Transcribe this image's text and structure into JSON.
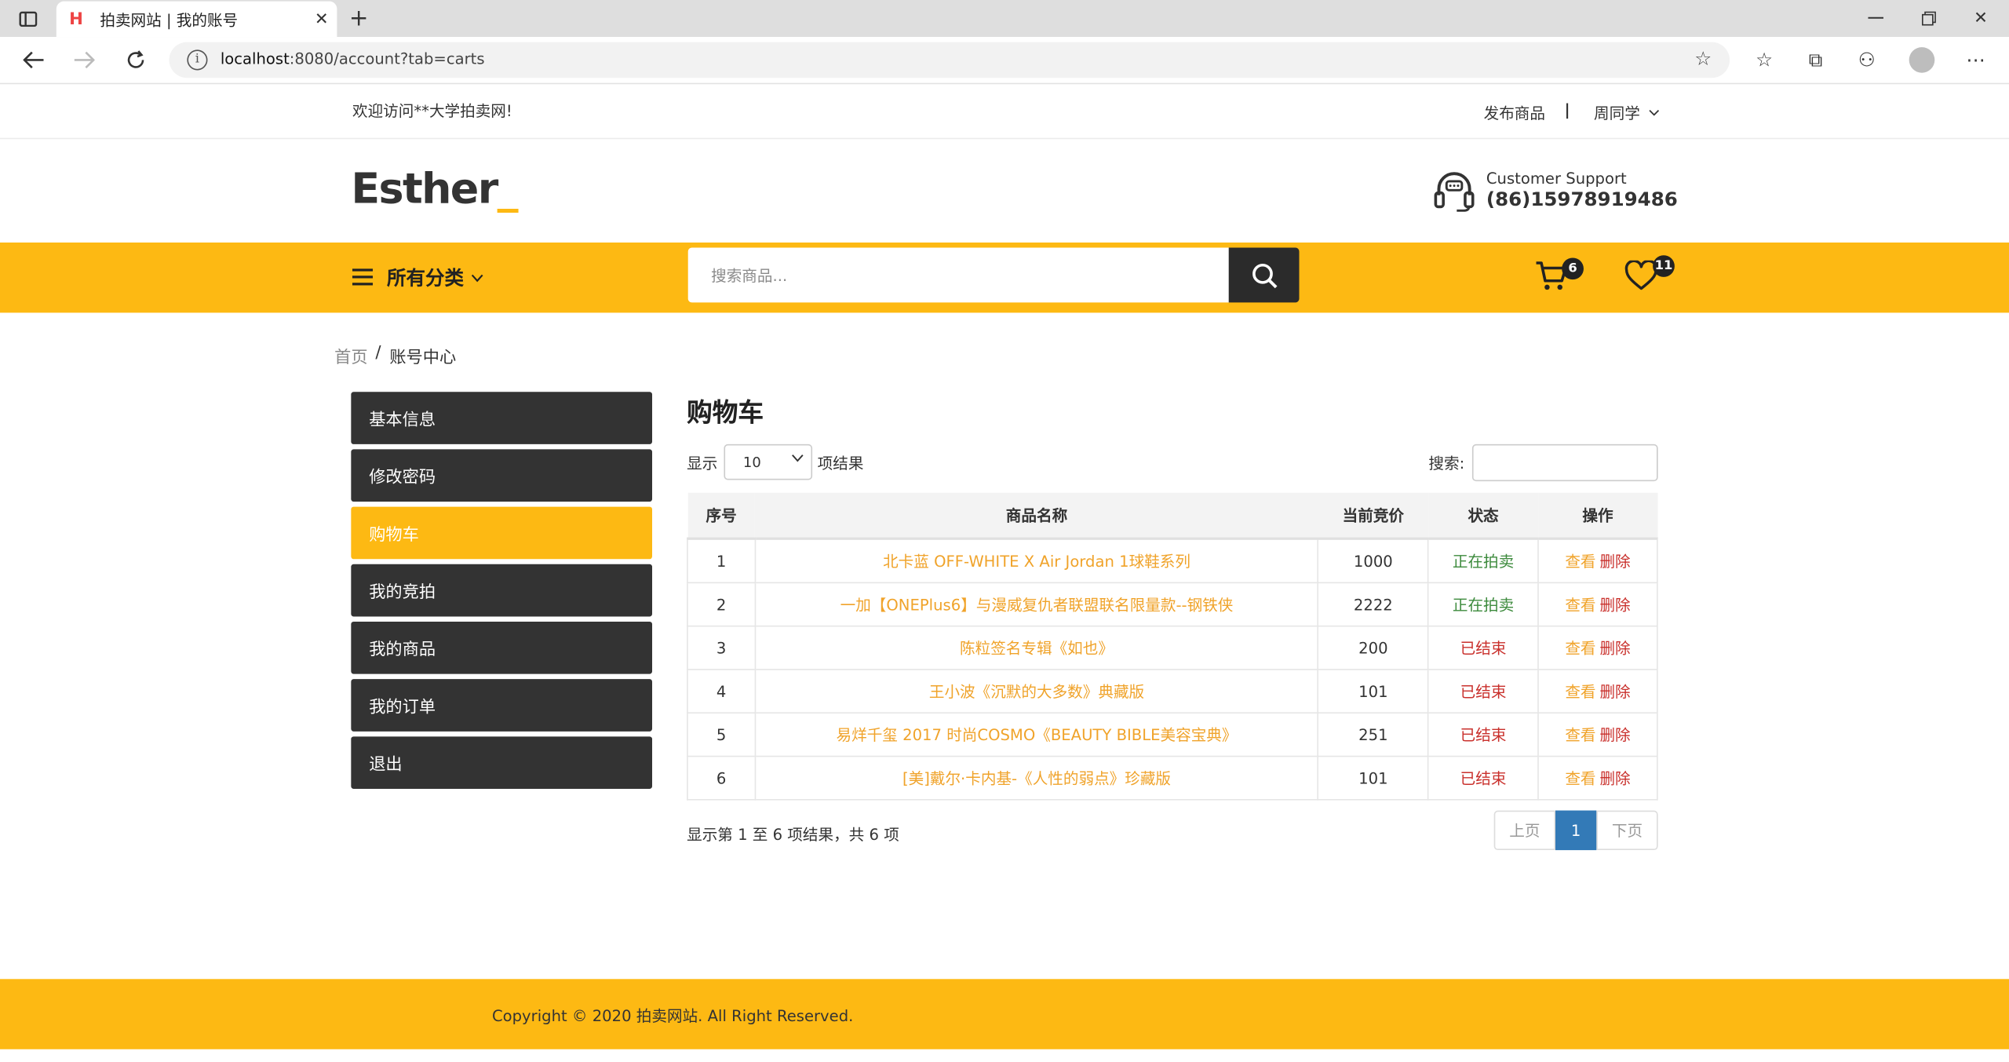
{
  "browser": {
    "tab_title": "拍卖网站 | 我的账号",
    "url_host": "localhost",
    "url_rest": ":8080/account?tab=carts"
  },
  "site": {
    "welcome": "欢迎访问**大学拍卖网!",
    "publish_link": "发布商品",
    "separator": "|",
    "user_menu": "周同学",
    "logo": "Esther",
    "logo_suffix": "_",
    "support_label": "Customer Support",
    "support_phone": "(86)15978919486",
    "all_categories": "所有分类",
    "search_placeholder": "搜索商品...",
    "cart_count": "6",
    "wishlist_count": "11",
    "accent_color": "#fdb913"
  },
  "breadcrumb": {
    "home": "首页",
    "sep": "/",
    "current": "账号中心"
  },
  "sidebar": {
    "items": [
      {
        "label": "基本信息",
        "active": false
      },
      {
        "label": "修改密码",
        "active": false
      },
      {
        "label": "购物车",
        "active": true
      },
      {
        "label": "我的竞拍",
        "active": false
      },
      {
        "label": "我的商品",
        "active": false
      },
      {
        "label": "我的订单",
        "active": false
      },
      {
        "label": "退出",
        "active": false
      }
    ]
  },
  "content": {
    "title": "购物车",
    "show_label": "显示",
    "page_size": "10",
    "results_label": "项结果",
    "search_label": "搜索:",
    "columns": [
      "序号",
      "商品名称",
      "当前竞价",
      "状态",
      "操作"
    ],
    "rows": [
      {
        "no": "1",
        "name": "北卡蓝 OFF-WHITE X Air Jordan 1球鞋系列",
        "price": "1000",
        "status": "正在拍卖",
        "status_kind": "live",
        "view": "查看",
        "delete": "删除"
      },
      {
        "no": "2",
        "name": "一加【ONEPlus6】与漫威复仇者联盟联名限量款--钢铁侠",
        "price": "2222",
        "status": "正在拍卖",
        "status_kind": "live",
        "view": "查看",
        "delete": "删除"
      },
      {
        "no": "3",
        "name": "陈粒签名专辑《如也》",
        "price": "200",
        "status": "已结束",
        "status_kind": "ended",
        "view": "查看",
        "delete": "删除"
      },
      {
        "no": "4",
        "name": "王小波《沉默的大多数》典藏版",
        "price": "101",
        "status": "已结束",
        "status_kind": "ended",
        "view": "查看",
        "delete": "删除"
      },
      {
        "no": "5",
        "name": "易烊千玺 2017 时尚COSMO《BEAUTY BIBLE美容宝典》",
        "price": "251",
        "status": "已结束",
        "status_kind": "ended",
        "view": "查看",
        "delete": "删除"
      },
      {
        "no": "6",
        "name": "[美]戴尔·卡内基-《人性的弱点》珍藏版",
        "price": "101",
        "status": "已结束",
        "status_kind": "ended",
        "view": "查看",
        "delete": "删除"
      }
    ],
    "info": "显示第 1 至 6 项结果，共 6 项",
    "pager": {
      "prev": "上页",
      "current": "1",
      "next": "下页"
    }
  },
  "footer": {
    "copyright": "Copyright © 2020 拍卖网站. All Right Reserved."
  }
}
